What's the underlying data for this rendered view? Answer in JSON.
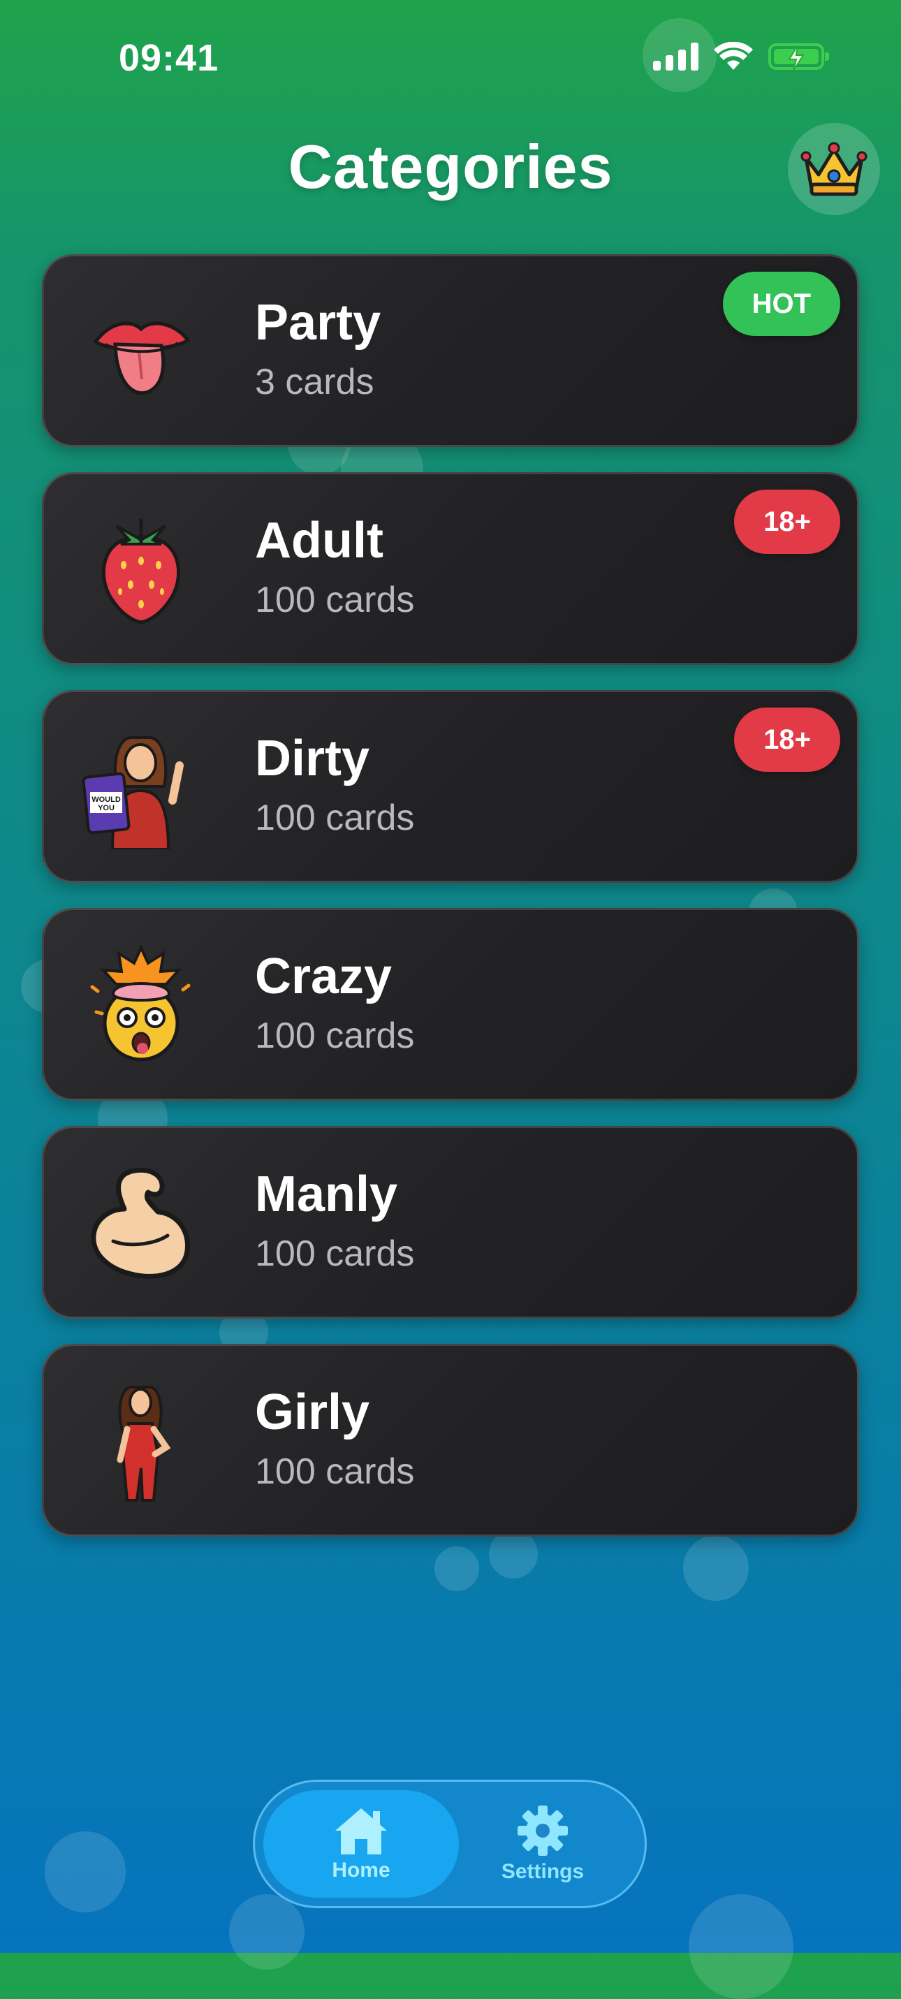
{
  "status_bar": {
    "time": "09:41"
  },
  "header": {
    "title": "Categories",
    "crown_icon": "crown-icon"
  },
  "categories": [
    {
      "name": "Party",
      "count": "3 cards",
      "badge": "HOT",
      "icon": "tongue-lips-icon"
    },
    {
      "name": "Adult",
      "count": "100 cards",
      "badge": "18+",
      "icon": "strawberry-icon"
    },
    {
      "name": "Dirty",
      "count": "100 cards",
      "badge": "18+",
      "icon": "woman-with-card-icon"
    },
    {
      "name": "Crazy",
      "count": "100 cards",
      "badge": "",
      "icon": "exploding-head-icon"
    },
    {
      "name": "Manly",
      "count": "100 cards",
      "badge": "",
      "icon": "flexed-biceps-icon"
    },
    {
      "name": "Girly",
      "count": "100 cards",
      "badge": "",
      "icon": "woman-red-dress-icon"
    }
  ],
  "tab_bar": {
    "tabs": [
      {
        "label": "Home",
        "icon": "home-icon",
        "active": true
      },
      {
        "label": "Settings",
        "icon": "gear-icon",
        "active": false
      }
    ]
  },
  "colors": {
    "hot_badge": "#33c257",
    "adult_badge": "#e23a47",
    "tab_active": "#19a6f0"
  }
}
